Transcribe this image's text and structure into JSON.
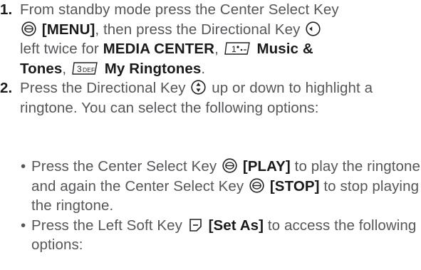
{
  "steps": [
    {
      "number": "1.",
      "parts": {
        "t1": "From standby mode press the Center Select Key",
        "menu": "[MENU]",
        "t2": ", then press the Directional Key",
        "t3": "left twice for",
        "media_center": "MEDIA CENTER",
        "comma1": ",",
        "music_tones": "Music &",
        "tones": "Tones",
        "comma2": ",",
        "my_ringtones": "My Ringtones",
        "period": "."
      }
    },
    {
      "number": "2.",
      "parts": {
        "t1": "Press the Directional Key",
        "t2": "up or down to highlight a ringtone. You can select the following options:"
      }
    }
  ],
  "bullets": [
    {
      "dot": "•",
      "t1": "Press the Center Select Key",
      "play": "[PLAY]",
      "t2": "to play the ringtone and again the Center Select Key",
      "stop": "[STOP]",
      "t3": "to stop playing the ringtone."
    },
    {
      "dot": "•",
      "t1": "Press the Left Soft Key",
      "set_as": "[Set As]",
      "t2": "to access the following options:"
    }
  ],
  "icons": {
    "center_select": "center-select-key-icon",
    "directional_left": "directional-left-key-icon",
    "directional_updown": "directional-updown-key-icon",
    "key_1": "key-1-icon",
    "key_3": "key-3-def-icon",
    "left_soft": "left-soft-key-icon"
  },
  "key_labels": {
    "key_1_digit": "1",
    "key_3_digit": "3",
    "key_3_letters": "DEF"
  }
}
